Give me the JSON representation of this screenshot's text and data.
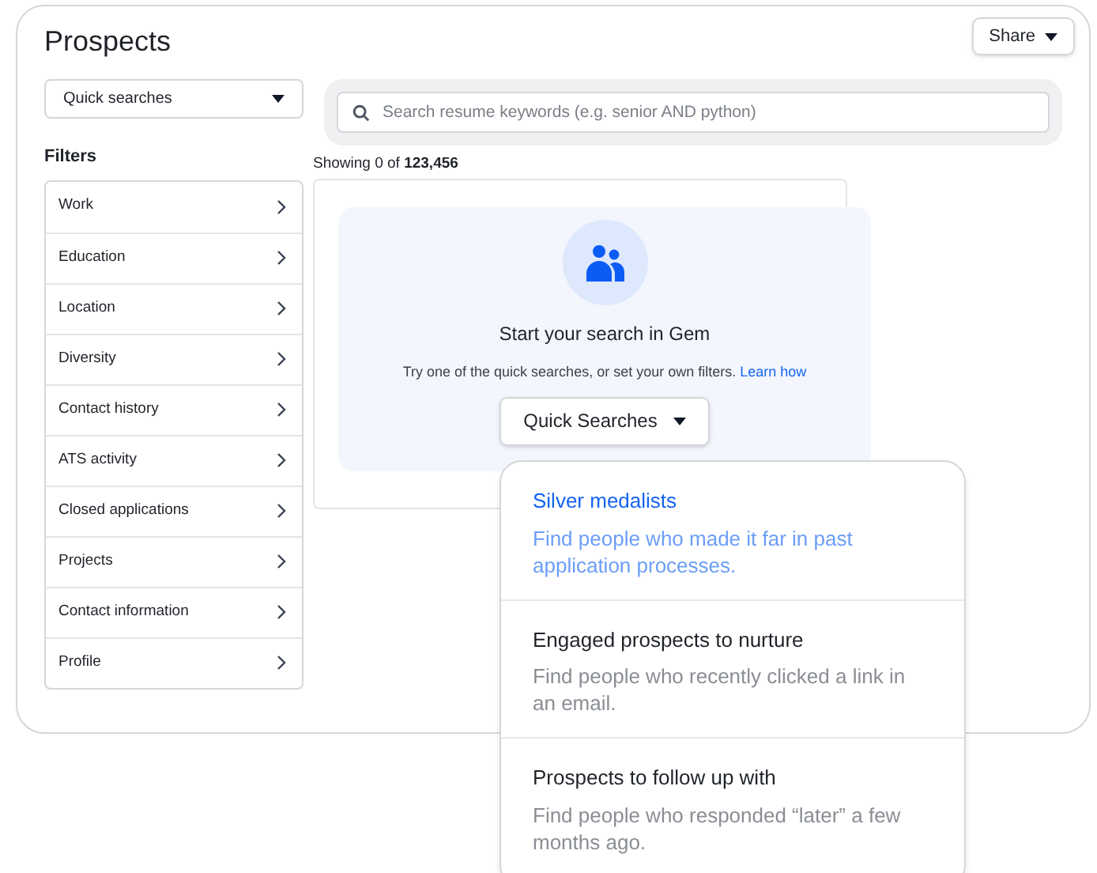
{
  "page": {
    "title": "Prospects"
  },
  "share_button": {
    "label": "Share"
  },
  "quick_searches_select": {
    "value": "Quick searches"
  },
  "filters": {
    "heading": "Filters",
    "items": [
      {
        "label": "Work"
      },
      {
        "label": "Education"
      },
      {
        "label": "Location"
      },
      {
        "label": "Diversity"
      },
      {
        "label": "Contact history"
      },
      {
        "label": "ATS activity"
      },
      {
        "label": "Closed applications"
      },
      {
        "label": "Projects"
      },
      {
        "label": "Contact information"
      },
      {
        "label": "Profile"
      }
    ]
  },
  "search": {
    "placeholder": "Search resume keywords (e.g. senior AND python)"
  },
  "results_count": "Showing 0 of **123,456**",
  "empty_state": {
    "title": "Start your search in Gem",
    "text": "Try one of the quick searches, or set your own filters.",
    "link": "Learn how",
    "button": "Quick Searches"
  },
  "quick_search_menu": [
    {
      "title": "Silver medalists",
      "description": "Find people who made it far in past application processes.",
      "selected": true
    },
    {
      "title": "Engaged prospects to nurture",
      "description": "Find people who recently clicked a link in an email.",
      "selected": false
    },
    {
      "title": "Prospects to follow up with",
      "description": "Find people who responded “later” a few months ago.",
      "selected": false
    }
  ]
}
